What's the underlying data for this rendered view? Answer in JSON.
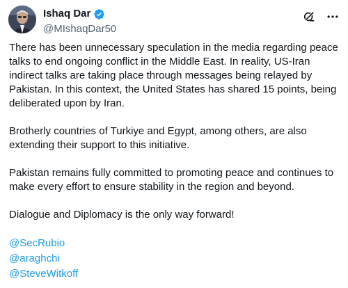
{
  "author": {
    "display_name": "Ishaq Dar",
    "handle": "@MIshaqDar50",
    "verified_color": "#1d9bf0"
  },
  "icons": {
    "avatar": "profile-photo",
    "verified": "verified-badge-icon",
    "grok": "grok-icon",
    "more": "more-options-icon"
  },
  "tweet": {
    "paragraphs": [
      "There has been unnecessary speculation in the media regarding peace talks to end ongoing conflict in the Middle East. In reality, US-Iran indirect talks are taking place through messages being relayed by Pakistan. In this context, the United States has shared 15 points, being deliberated upon by Iran.",
      "Brotherly countries of Turkiye and Egypt, among others, are also extending their support to this initiative.",
      "Pakistan remains fully committed to promoting peace and continues to make every effort to ensure stability in the region and beyond.",
      "Dialogue and Diplomacy is the only way forward!"
    ],
    "mentions": [
      "@SecRubio",
      "@araghchi",
      "@SteveWitkoff"
    ]
  },
  "colors": {
    "text": "#0f1419",
    "secondary": "#536471",
    "link": "#1d9bf0"
  }
}
